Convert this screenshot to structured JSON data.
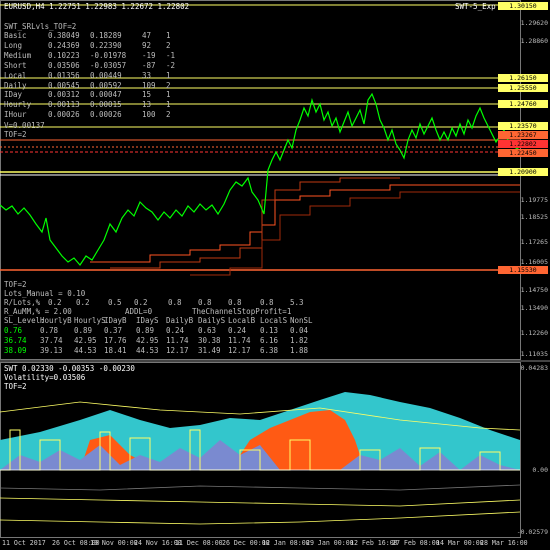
{
  "window": {
    "symbol_title": "EURUSD,H4 1.22751 1.22983 1.22672 1.22802",
    "indicator_title_top": "SWT-5_Exp"
  },
  "panel_top": {
    "header": "SWT_SRLvls_TOF=2",
    "rows": [
      {
        "name": "Basic",
        "a": "0.38049",
        "b": "0.18289",
        "c": "47",
        "d": "1"
      },
      {
        "name": "Long",
        "a": "0.24369",
        "b": "0.22390",
        "c": "92",
        "d": "2"
      },
      {
        "name": "Medium",
        "a": "0.10223",
        "b": "-0.01978",
        "c": "-19",
        "d": "-1"
      },
      {
        "name": "Short",
        "a": "0.03506",
        "b": "-0.03057",
        "c": "-87",
        "d": "-2"
      },
      {
        "name": "Local",
        "a": "0.01356",
        "b": "0.00449",
        "c": "33",
        "d": "1"
      },
      {
        "name": "Daily",
        "a": "0.00545",
        "b": "0.00592",
        "c": "109",
        "d": "2"
      },
      {
        "name": "IDay",
        "a": "0.00312",
        "b": "0.00047",
        "c": "15",
        "d": "1"
      },
      {
        "name": "Hourly",
        "a": "0.00113",
        "b": "0.00015",
        "c": "13",
        "d": "1"
      },
      {
        "name": "IHour",
        "a": "0.00026",
        "b": "0.00026",
        "c": "100",
        "d": "2"
      }
    ],
    "vol": "V=0.00137",
    "tof_label": "TOF=2"
  },
  "panel_bottom": {
    "tof_label": "TOF=2",
    "lots_manual": "Lots_Manual = 0.10",
    "rlots_label": "R/Lots,%",
    "rlots_values": [
      "0.2",
      "0.2",
      "0.5",
      "0.2",
      "0.8",
      "0.8",
      "0.8",
      "0.8",
      "5.3"
    ],
    "r_aumm": "R_AuMM,% = 2.00",
    "addl": "ADDL=0",
    "channel_stop": "TheChannelStopProfit=1",
    "sl_header": [
      "SL_Level:",
      "HourlyB",
      "HourlyS",
      "IDayB",
      "IDayS",
      "DailyB",
      "DailyS",
      "LocalB",
      "LocalS",
      "NonSL"
    ],
    "sl_row1": [
      "0.76",
      "0.78",
      "0.89",
      "0.37",
      "0.89",
      "0.24",
      "0.63",
      "0.24",
      "0.13",
      "0.04"
    ],
    "sl_row2": [
      "36.74",
      "37.74",
      "42.95",
      "17.76",
      "42.95",
      "11.74",
      "30.38",
      "11.74",
      "6.16",
      "1.82"
    ],
    "sl_row3": [
      "38.09",
      "39.13",
      "44.53",
      "18.41",
      "44.53",
      "12.17",
      "31.49",
      "12.17",
      "6.38",
      "1.88"
    ]
  },
  "price_axis": [
    {
      "label": "1.30150",
      "tag": true,
      "color": "#ffff66"
    },
    {
      "label": "1.29620",
      "tag": false
    },
    {
      "label": "1.28860",
      "tag": false
    },
    {
      "label": "1.26150",
      "tag": true,
      "color": "#ffff66"
    },
    {
      "label": "1.25550",
      "tag": true,
      "color": "#ffff66"
    },
    {
      "label": "1.24760",
      "tag": true,
      "color": "#ffff66"
    },
    {
      "label": "1.23570",
      "tag": true,
      "color": "#ffff66"
    },
    {
      "label": "1.23267",
      "tag": true,
      "color": "#ff6633"
    },
    {
      "label": "1.22802",
      "tag": true,
      "color": "#ff3333"
    },
    {
      "label": "1.22450",
      "tag": true,
      "color": "#ff6633"
    },
    {
      "label": "1.20900",
      "tag": true,
      "color": "#ffff66"
    },
    {
      "label": "1.19775",
      "tag": false
    },
    {
      "label": "1.18525",
      "tag": false
    },
    {
      "label": "1.17265",
      "tag": false
    },
    {
      "label": "1.16005",
      "tag": false
    },
    {
      "label": "1.15530",
      "tag": true,
      "color": "#ff6633"
    },
    {
      "label": "1.14750",
      "tag": false
    },
    {
      "label": "1.13490",
      "tag": false
    },
    {
      "label": "1.12260",
      "tag": false
    },
    {
      "label": "1.11035",
      "tag": false
    }
  ],
  "sub_window": {
    "line1": "SWT 0.02330 -0.00353 -0.00230",
    "line2": "Volatility=0.03506",
    "line3": "TOF=2",
    "axis_top": "0.04283",
    "axis_mid": "0.00",
    "axis_bottom": "-0.02579"
  },
  "dates": [
    "11 Oct 2017",
    "26 Oct 08:00",
    "10 Nov 00:00",
    "24 Nov 16:00",
    "11 Dec 08:00",
    "26 Dec 00:00",
    "12 Jan 08:00",
    "29 Jan 00:00",
    "12 Feb 16:00",
    "27 Feb 08:00",
    "14 Mar 00:00",
    "28 Mar 16:00"
  ]
}
